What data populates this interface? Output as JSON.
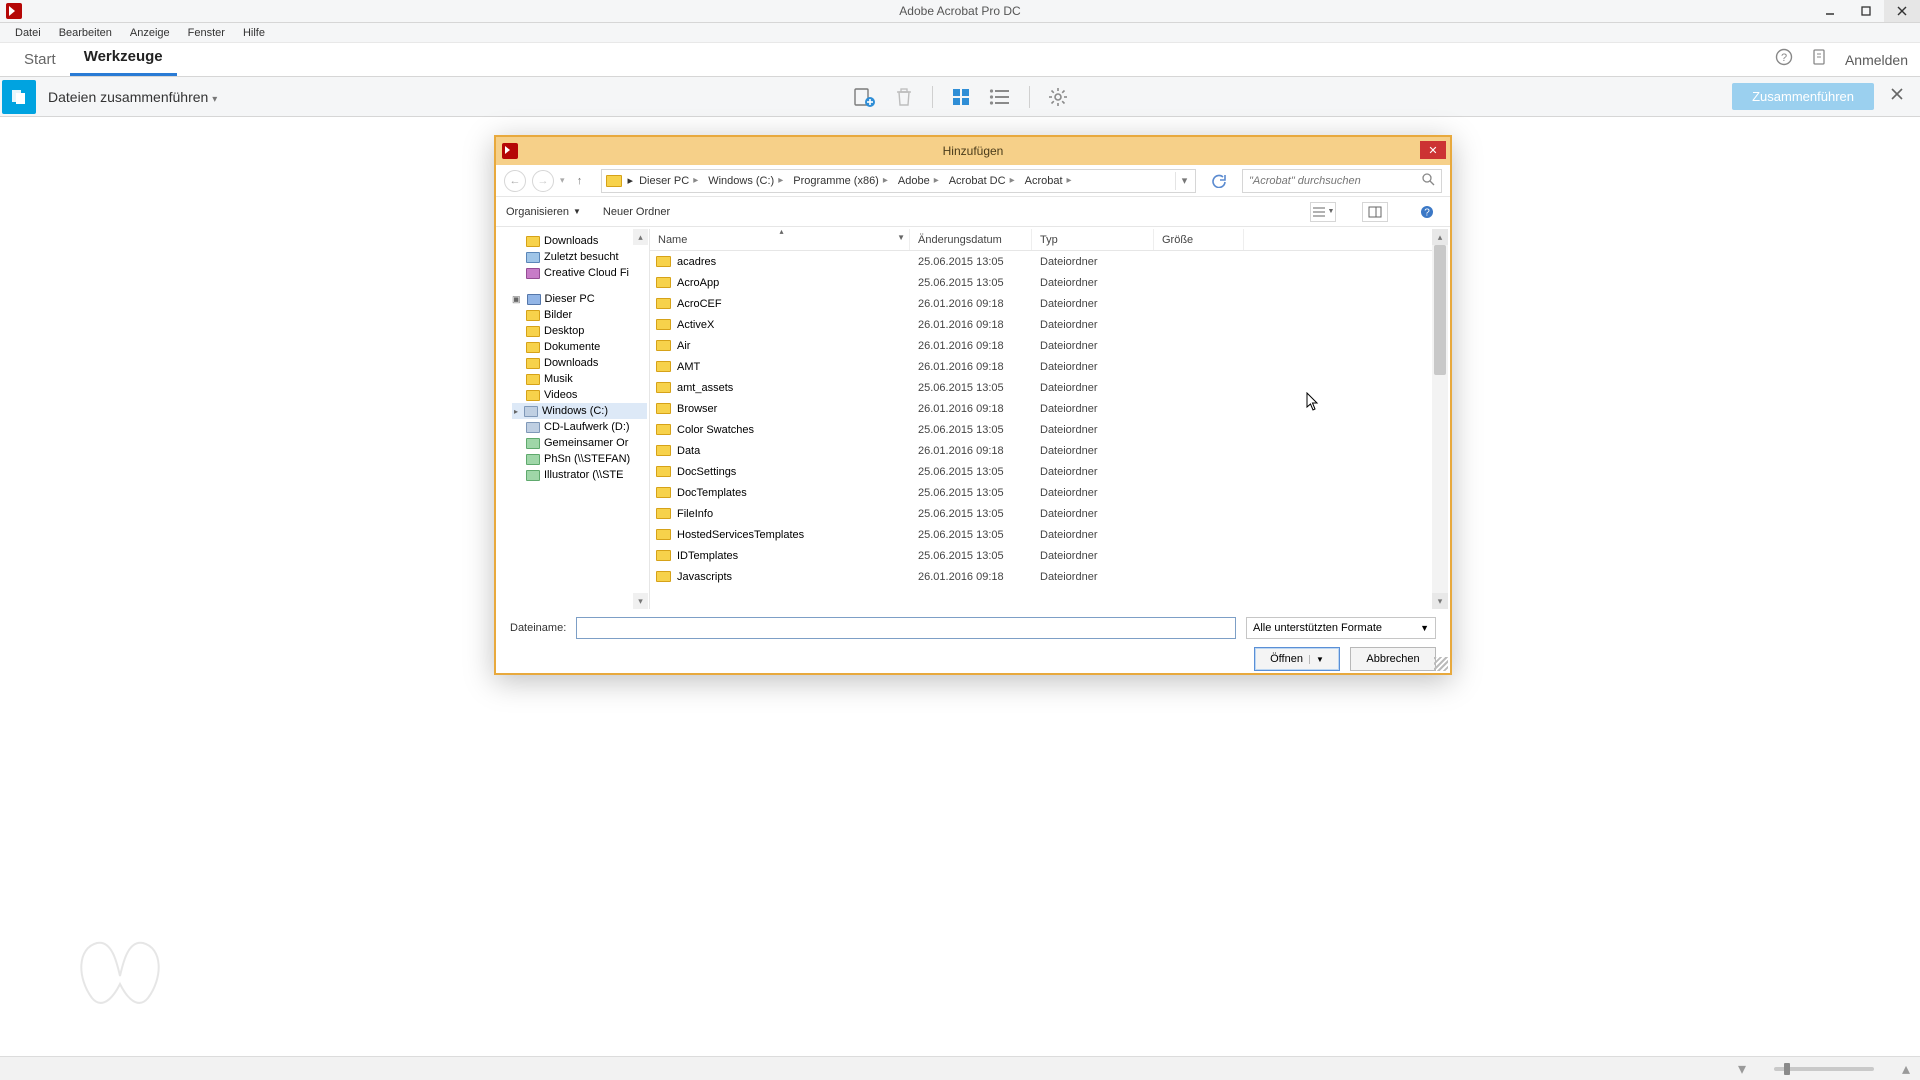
{
  "window": {
    "title": "Adobe Acrobat Pro DC",
    "menus": [
      "Datei",
      "Bearbeiten",
      "Anzeige",
      "Fenster",
      "Hilfe"
    ],
    "tabs": {
      "start": "Start",
      "tools": "Werkzeuge"
    },
    "signin": "Anmelden"
  },
  "toolbar": {
    "label": "Dateien zusammenführen",
    "primary": "Zusammenführen"
  },
  "dialog": {
    "title": "Hinzufügen",
    "organize": "Organisieren",
    "new_folder": "Neuer Ordner",
    "breadcrumb": [
      "Dieser PC",
      "Windows (C:)",
      "Programme (x86)",
      "Adobe",
      "Acrobat DC",
      "Acrobat"
    ],
    "search_placeholder": "\"Acrobat\" durchsuchen",
    "tree": {
      "quick": [
        "Downloads",
        "Zuletzt besucht",
        "Creative Cloud Fi"
      ],
      "pc": "Dieser PC",
      "pc_children": [
        "Bilder",
        "Desktop",
        "Dokumente",
        "Downloads",
        "Musik",
        "Videos",
        "Windows (C:)",
        "CD-Laufwerk (D:)",
        "Gemeinsamer Or",
        "PhSn (\\\\STEFAN)",
        "Illustrator (\\\\STE"
      ]
    },
    "columns": {
      "name": "Name",
      "date": "Änderungsdatum",
      "type": "Typ",
      "size": "Größe"
    },
    "rows": [
      {
        "name": "acadres",
        "date": "25.06.2015 13:05",
        "type": "Dateiordner"
      },
      {
        "name": "AcroApp",
        "date": "25.06.2015 13:05",
        "type": "Dateiordner"
      },
      {
        "name": "AcroCEF",
        "date": "26.01.2016 09:18",
        "type": "Dateiordner"
      },
      {
        "name": "ActiveX",
        "date": "26.01.2016 09:18",
        "type": "Dateiordner"
      },
      {
        "name": "Air",
        "date": "26.01.2016 09:18",
        "type": "Dateiordner"
      },
      {
        "name": "AMT",
        "date": "26.01.2016 09:18",
        "type": "Dateiordner"
      },
      {
        "name": "amt_assets",
        "date": "25.06.2015 13:05",
        "type": "Dateiordner"
      },
      {
        "name": "Browser",
        "date": "26.01.2016 09:18",
        "type": "Dateiordner"
      },
      {
        "name": "Color Swatches",
        "date": "25.06.2015 13:05",
        "type": "Dateiordner"
      },
      {
        "name": "Data",
        "date": "26.01.2016 09:18",
        "type": "Dateiordner"
      },
      {
        "name": "DocSettings",
        "date": "25.06.2015 13:05",
        "type": "Dateiordner"
      },
      {
        "name": "DocTemplates",
        "date": "25.06.2015 13:05",
        "type": "Dateiordner"
      },
      {
        "name": "FileInfo",
        "date": "25.06.2015 13:05",
        "type": "Dateiordner"
      },
      {
        "name": "HostedServicesTemplates",
        "date": "25.06.2015 13:05",
        "type": "Dateiordner"
      },
      {
        "name": "IDTemplates",
        "date": "25.06.2015 13:05",
        "type": "Dateiordner"
      },
      {
        "name": "Javascripts",
        "date": "26.01.2016 09:18",
        "type": "Dateiordner"
      }
    ],
    "filename_label": "Dateiname:",
    "format": "Alle unterstützten Formate",
    "open": "Öffnen",
    "cancel": "Abbrechen"
  }
}
